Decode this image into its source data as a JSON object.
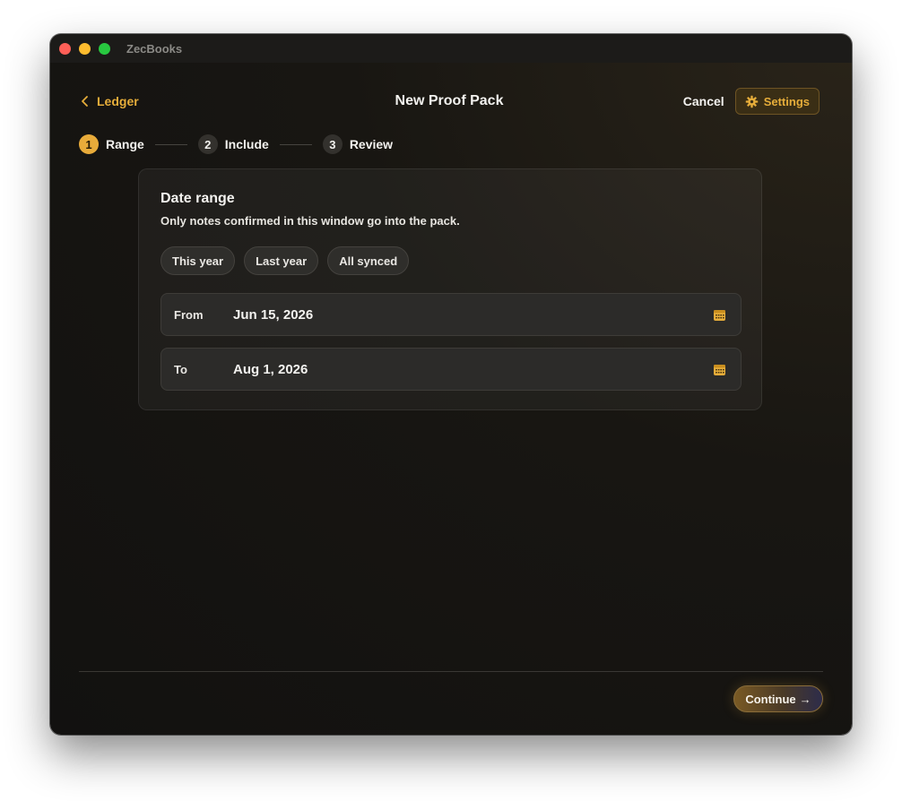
{
  "window": {
    "app_title": "ZecBooks"
  },
  "header": {
    "back_label": "Ledger",
    "title": "New Proof Pack",
    "cancel_label": "Cancel",
    "settings_label": "Settings"
  },
  "steps": [
    {
      "number": "1",
      "label": "Range",
      "active": true
    },
    {
      "number": "2",
      "label": "Include",
      "active": false
    },
    {
      "number": "3",
      "label": "Review",
      "active": false
    }
  ],
  "date_range": {
    "title": "Date range",
    "subtitle": "Only notes confirmed in this window go into the pack.",
    "presets": [
      "This year",
      "Last year",
      "All synced"
    ],
    "from_label": "From",
    "from_value": "Jun 15, 2026",
    "to_label": "To",
    "to_value": "Aug 1, 2026"
  },
  "footer": {
    "continue_label": "Continue",
    "continue_arrow": "→"
  },
  "colors": {
    "accent": "#e6ad3a",
    "text_primary": "#f3f2ef",
    "background": "#181612"
  },
  "icons": {
    "back": "chevron-left-icon",
    "settings": "gear-icon",
    "date": "calendar-icon",
    "continue": "arrow-right-icon"
  }
}
